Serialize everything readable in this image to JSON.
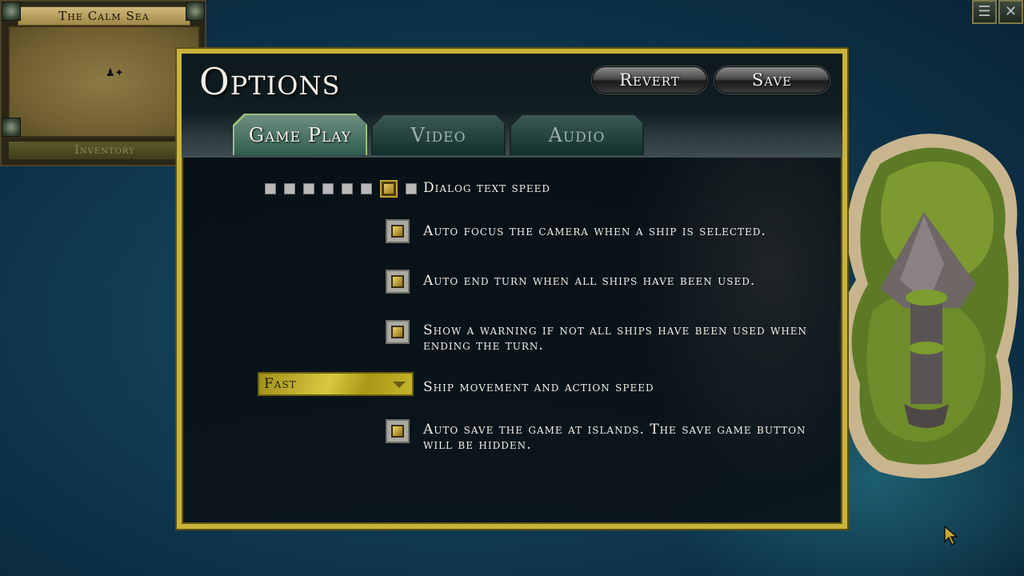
{
  "minimap": {
    "title": "The Calm Sea",
    "inventory_label": "Inventory"
  },
  "top_right_buttons": [
    {
      "icon": "list-icon",
      "glyph": "☰"
    },
    {
      "icon": "close-icon",
      "glyph": "✕"
    }
  ],
  "options": {
    "title": "Options",
    "revert_label": "Revert",
    "save_label": "Save",
    "tabs": [
      {
        "label": "Game Play",
        "active": true
      },
      {
        "label": "Video",
        "active": false
      },
      {
        "label": "Audio",
        "active": false
      }
    ],
    "dialog_speed": {
      "label": "Dialog text speed",
      "steps": 8,
      "selected_step": 7
    },
    "auto_focus": {
      "label": "Auto focus the camera when a ship is selected.",
      "checked": true
    },
    "auto_end_turn": {
      "label": "Auto end turn when all ships have been used.",
      "checked": true
    },
    "show_warning": {
      "label": "Show a warning if not all ships have been used when ending the turn.",
      "checked": true
    },
    "ship_speed": {
      "label": "Ship movement and action speed",
      "selected": "Fast"
    },
    "auto_save": {
      "label": "Auto save the game at islands. The save game button will be hidden.",
      "checked": true
    }
  },
  "colors": {
    "panel_border": "#c9b33a",
    "tab_active": "#2f5c4f",
    "sea": "#133f55"
  }
}
